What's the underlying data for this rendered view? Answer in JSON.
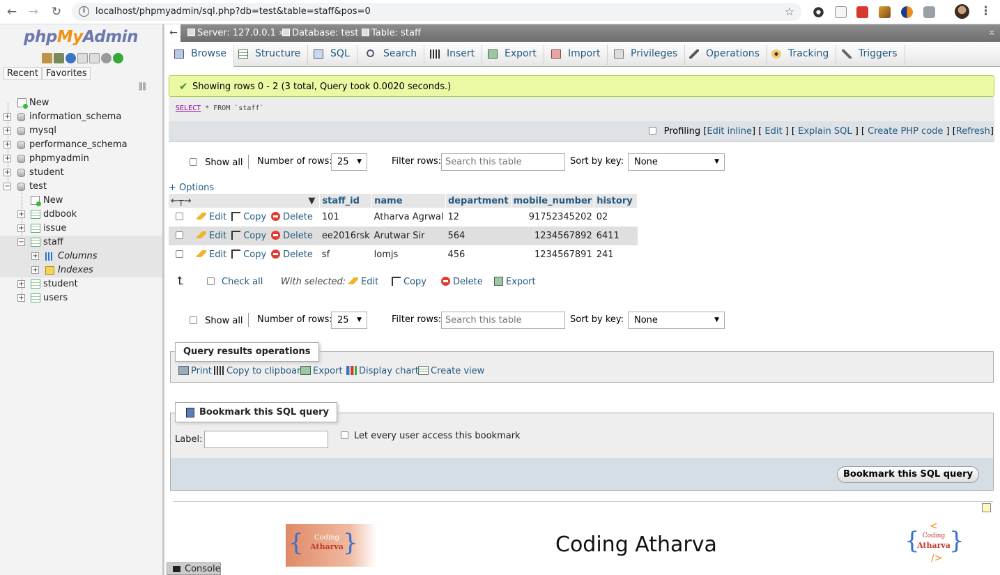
{
  "browser": {
    "url": "localhost/phpmyadmin/sql.php?db=test&table=staff&pos=0"
  },
  "sidebar": {
    "logo": {
      "php": "php",
      "my": "My",
      "admin": "Admin"
    },
    "tabs": [
      "Recent",
      "Favorites"
    ],
    "tree": {
      "new": "New",
      "databases": [
        "information_schema",
        "mysql",
        "performance_schema",
        "phpmyadmin",
        "student",
        "test"
      ],
      "test_children": {
        "new": "New",
        "tables": [
          "ddbook",
          "issue",
          "staff",
          "student",
          "users"
        ],
        "staff_children": [
          "Columns",
          "Indexes"
        ]
      }
    }
  },
  "breadcrumb": {
    "server": "Server: 127.0.0.1",
    "database": "Database: test",
    "table": "Table: staff"
  },
  "tabs": [
    "Browse",
    "Structure",
    "SQL",
    "Search",
    "Insert",
    "Export",
    "Import",
    "Privileges",
    "Operations",
    "Tracking",
    "Triggers"
  ],
  "message": {
    "success": "Showing rows 0 - 2 (3 total, Query took 0.0020 seconds.)",
    "sql_keyword": "SELECT",
    "sql_rest": " * FROM `staff`"
  },
  "profiling": {
    "label": "Profiling",
    "links": [
      "Edit inline",
      "Edit",
      "Explain SQL",
      "Create PHP code",
      "Refresh"
    ]
  },
  "nav": {
    "show_all": "Show all",
    "number_of_rows_label": "Number of rows:",
    "number_of_rows_value": "25",
    "filter_rows_label": "Filter rows:",
    "filter_placeholder": "Search this table",
    "sort_by_key_label": "Sort by key:",
    "sort_by_key_value": "None"
  },
  "options_link": "+ Options",
  "table": {
    "columns": [
      "staff_id",
      "name",
      "department",
      "mobile_number",
      "history"
    ],
    "actions": {
      "edit": "Edit",
      "copy": "Copy",
      "delete": "Delete"
    },
    "rows": [
      [
        "101",
        "Atharva Agrwal",
        "12",
        "91752345202",
        "02"
      ],
      [
        "ee2016rsk",
        "Arutwar Sir",
        "564",
        "1234567892",
        "6411"
      ],
      [
        "sf",
        "lomjs",
        "456",
        "1234567891",
        "241"
      ]
    ]
  },
  "with_selected": {
    "check_all": "Check all",
    "label": "With selected:",
    "edit": "Edit",
    "copy": "Copy",
    "delete": "Delete",
    "export": "Export"
  },
  "query_results_operations": {
    "legend": "Query results operations",
    "print": "Print",
    "copy_to_clipboard": "Copy to clipboard",
    "export": "Export",
    "display_chart": "Display chart",
    "create_view": "Create view"
  },
  "bookmark": {
    "legend": "Bookmark this SQL query",
    "label": "Label:",
    "every_user": "Let every user access this bookmark",
    "submit": "Bookmark this SQL query"
  },
  "console": "Console",
  "watermark": {
    "coding": "Coding",
    "atharva": "Atharva",
    "title": "Coding Atharva"
  }
}
